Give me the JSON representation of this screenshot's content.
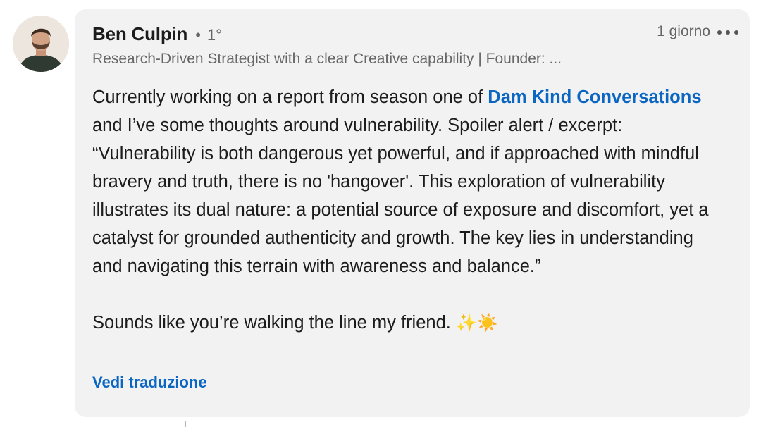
{
  "comment": {
    "author": {
      "name": "Ben Culpin",
      "separator": "•",
      "connection_degree": "1°",
      "headline": "Research-Driven Strategist with a clear Creative capability | Founder: ..."
    },
    "timestamp": "1 giorno",
    "more_icon": "more-horizontal-icon",
    "body": {
      "intro": "Currently working on a report from season one of ",
      "mention": "Dam Kind Conversations",
      "main": " and I’ve some thoughts around vulnerability. Spoiler alert / excerpt: “Vulnerability is both dangerous yet powerful, and if approached with mindful bravery and truth, there is no 'hangover'. This exploration of vulnerability illustrates its dual nature: a potential source of exposure and discomfort, yet a catalyst for grounded authenticity and growth. The key lies in understanding and navigating this terrain with awareness and balance.”",
      "closing": "Sounds like you’re walking the line my friend. ",
      "closing_emoji": "✨☀️"
    },
    "translate_label": "Vedi traduzione"
  },
  "colors": {
    "bubble_bg": "#f2f2f2",
    "link": "#0a66c2",
    "text_primary": "#1c1c1c",
    "text_secondary": "#666666"
  }
}
